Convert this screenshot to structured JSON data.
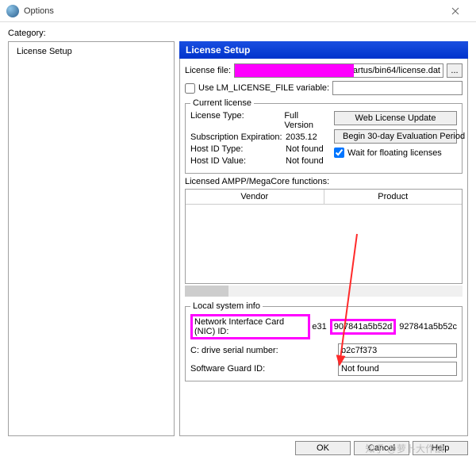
{
  "window": {
    "title": "Options"
  },
  "category_label": "Category:",
  "tree": {
    "items": [
      "License Setup"
    ]
  },
  "panel": {
    "title": "License Setup"
  },
  "license_file": {
    "label": "License file:",
    "value": "quartus/bin64/license.dat",
    "browse": "..."
  },
  "lm_var": {
    "label": "Use LM_LICENSE_FILE variable:",
    "checked": false,
    "value": ""
  },
  "current_license": {
    "legend": "Current license",
    "type_k": "License Type:",
    "type_v": "Full Version",
    "exp_k": "Subscription Expiration:",
    "exp_v": "2035.12",
    "hidtype_k": "Host ID Type:",
    "hidtype_v": "Not found",
    "hidval_k": "Host ID Value:",
    "hidval_v": "Not found",
    "web_btn": "Web License Update",
    "eval_btn": "Begin 30-day Evaluation Period",
    "wait_label": "Wait for floating licenses",
    "wait_checked": true
  },
  "functions": {
    "label": "Licensed AMPP/MegaCore functions:",
    "col_vendor": "Vendor",
    "col_product": "Product"
  },
  "local": {
    "legend": "Local system info",
    "nic_label": "Network Interface Card (NIC) ID:",
    "nic_prefix": "e31",
    "nic_highlight": "907841a5b52d",
    "nic_suffix": "927841a5b52c",
    "cdrive_k": "C: drive serial number:",
    "cdrive_v": "b2c7f373",
    "sguard_k": "Software Guard ID:",
    "sguard_v": "Not found"
  },
  "footer": {
    "ok": "OK",
    "cancel": "Cancel",
    "help": "Help"
  },
  "watermark": "知乎 @萝卜大作战"
}
